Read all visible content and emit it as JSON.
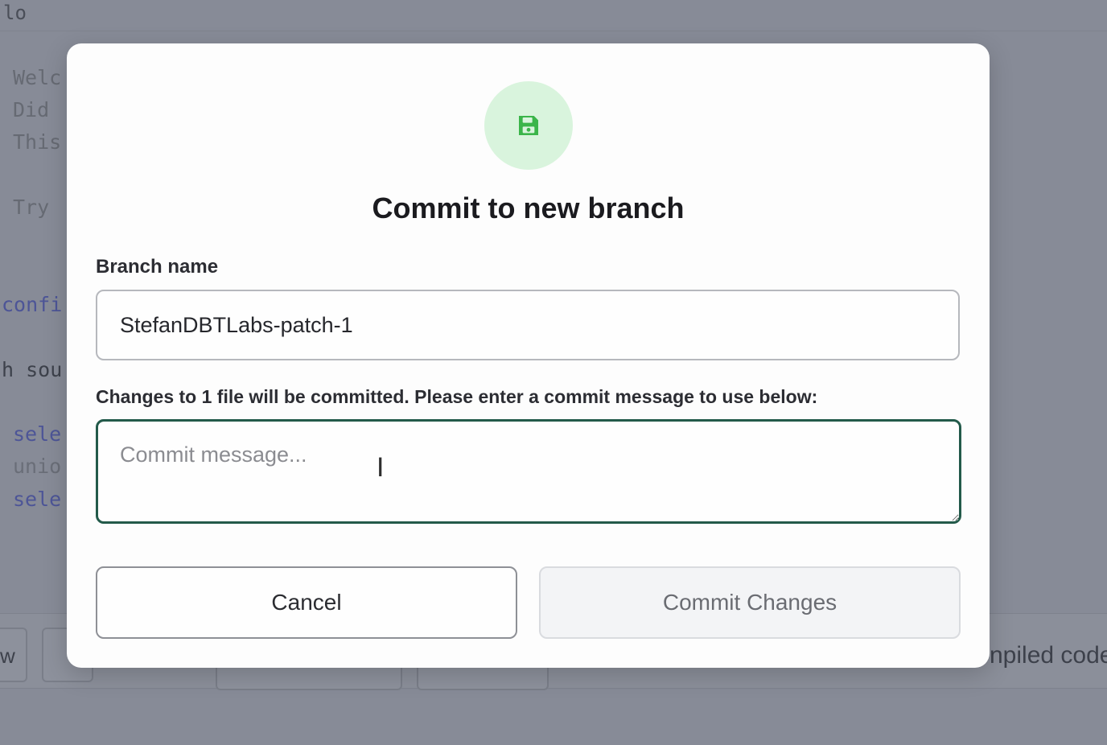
{
  "background": {
    "tab_label": "lo",
    "code_lines": [
      {
        "text": "Welc",
        "style": "comment"
      },
      {
        "text": "Did ",
        "style": "comment"
      },
      {
        "text": "This",
        "style": "comment"
      },
      {
        "text": "Try ",
        "style": "comment"
      },
      {
        "text": "confi",
        "style": "config"
      },
      {
        "text": "h sou",
        "style": "plain"
      },
      {
        "text": "sele",
        "style": "keyword"
      },
      {
        "text": "unio",
        "style": "faint"
      },
      {
        "text": "sele",
        "style": "keyword"
      }
    ],
    "bottom_left_text": "w",
    "compiled_label": "npiled code"
  },
  "modal": {
    "icon": "floppy-disk-icon",
    "accent_color": "#3bb54a",
    "title": "Commit to new branch",
    "branch_label": "Branch name",
    "branch_value": "StefanDBTLabs-patch-1",
    "changes_note": "Changes to 1 file will be committed. Please enter a commit message to use below:",
    "commit_placeholder": "Commit message...",
    "commit_value": "",
    "cancel_label": "Cancel",
    "commit_label": "Commit Changes"
  }
}
